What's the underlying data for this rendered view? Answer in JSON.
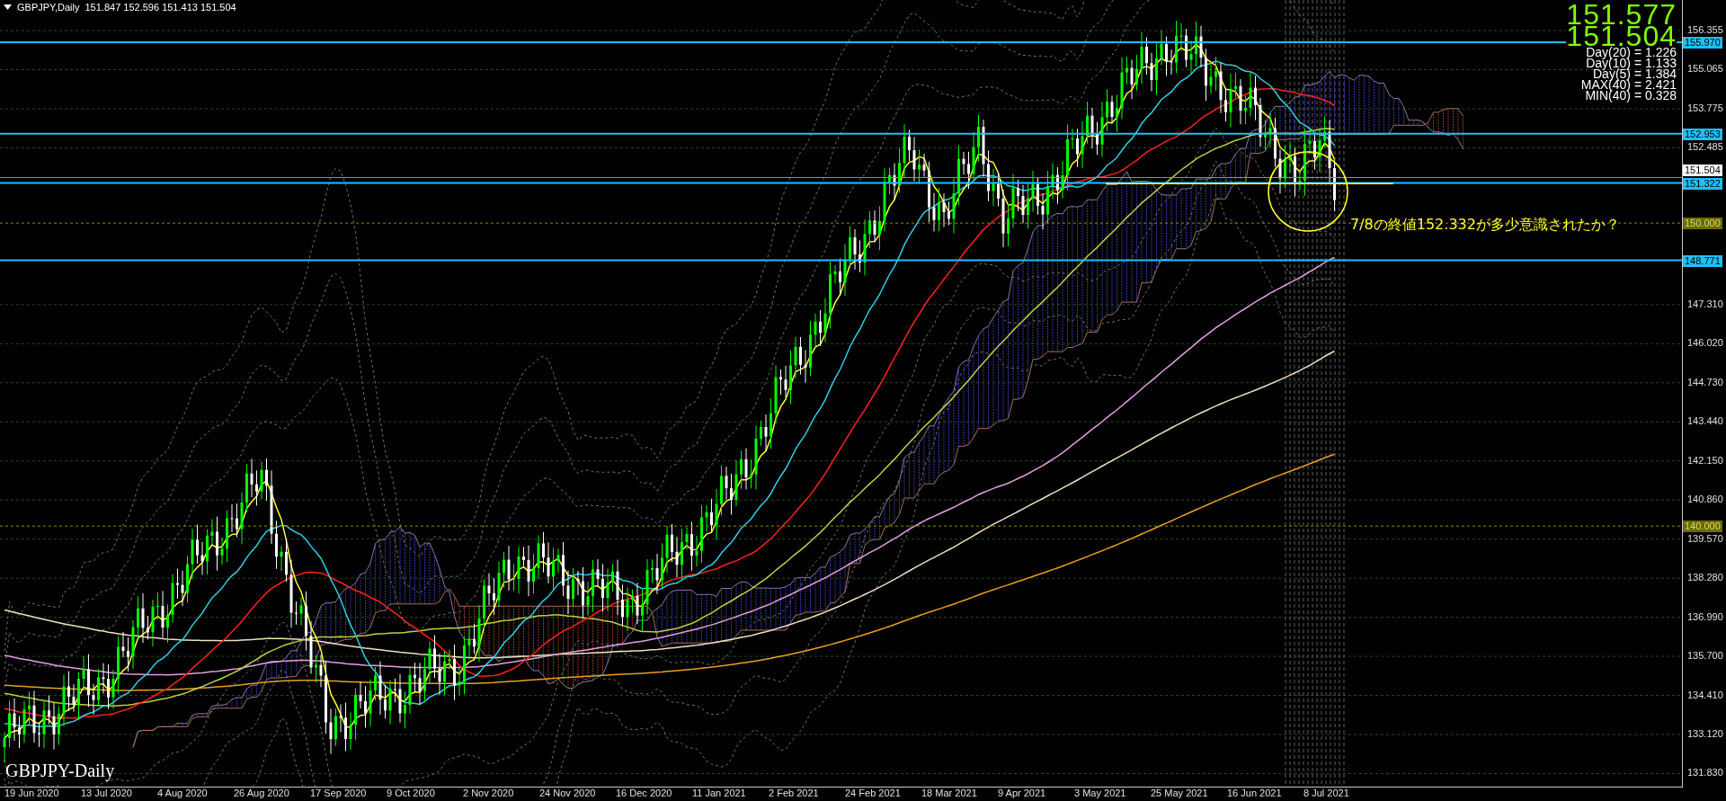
{
  "header": {
    "symbol_timeframe": "GBPJPY,Daily",
    "ohlc": [
      "151.847",
      "152.596",
      "151.413",
      "151.504"
    ]
  },
  "price_readout": [
    "151.577",
    "151.504"
  ],
  "volatility_stats": [
    "Day(20) = 1.226",
    "Day(10) = 1.133",
    "Day(5) = 1.384",
    "MAX(40) = 2.421",
    "MIN(40) = 0.328"
  ],
  "annotation": "7/8の終値152.332が多少意識されたか？",
  "chart_label": "GBPJPY-Daily",
  "price_axis": {
    "ticks": [
      "156.355",
      "155.065",
      "153.775",
      "152.485",
      "147.310",
      "146.020",
      "144.730",
      "143.440",
      "142.150",
      "140.860",
      "139.570",
      "138.280",
      "136.990",
      "135.700",
      "134.410",
      "133.120",
      "131.830"
    ],
    "tags": [
      {
        "label": "155.970",
        "kind": "line"
      },
      {
        "label": "152.953",
        "kind": "line"
      },
      {
        "label": "151.504",
        "kind": "bid"
      },
      {
        "label": "151.322",
        "kind": "line"
      },
      {
        "label": "150.000",
        "kind": "round"
      },
      {
        "label": "148.771",
        "kind": "line"
      },
      {
        "label": "140.000",
        "kind": "round"
      }
    ]
  },
  "time_axis": {
    "ticks": [
      "19 Jun 2020",
      "13 Jul 2020",
      "4 Aug 2020",
      "26 Aug 2020",
      "17 Sep 2020",
      "9 Oct 2020",
      "2 Nov 2020",
      "24 Nov 2020",
      "16 Dec 2020",
      "11 Jan 2021",
      "2 Feb 2021",
      "24 Feb 2021",
      "18 Mar 2021",
      "9 Apr 2021",
      "3 May 2021",
      "25 May 2021",
      "16 Jun 2021",
      "8 Jul 2021"
    ]
  }
}
